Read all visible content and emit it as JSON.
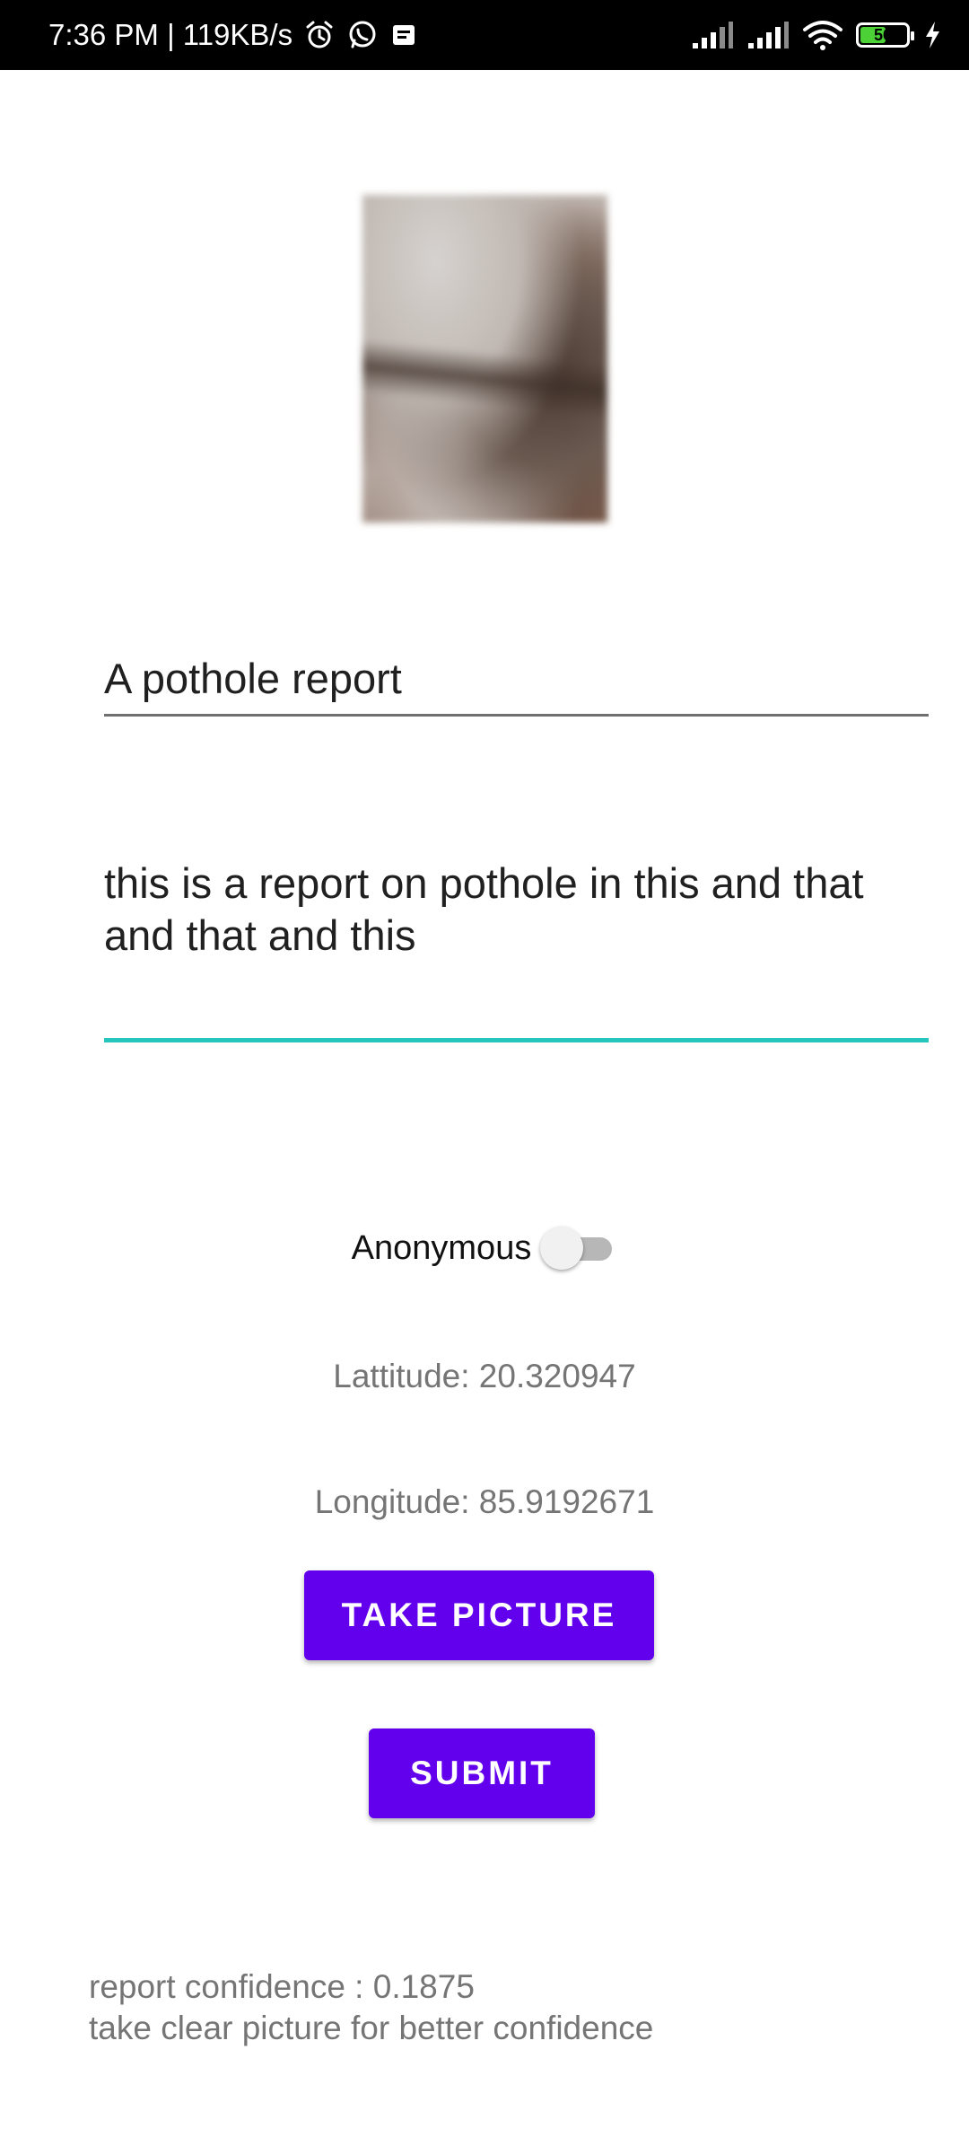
{
  "status_bar": {
    "time_speed": "7:36 PM | 119KB/s",
    "battery_level": "56",
    "battery_fraction": 0.56,
    "icons": [
      "alarm-icon",
      "whatsapp-icon",
      "message-icon",
      "signal-icon",
      "signal-icon",
      "wifi-icon",
      "battery-icon",
      "charging-icon"
    ]
  },
  "form": {
    "title_value": "A pothole report",
    "description_value": "this is a report on pothole in this and that and that and this",
    "anonymous_label": "Anonymous",
    "anonymous_on": false,
    "latitude_text": "Lattitude: 20.320947",
    "longitude_text": "Longitude: 85.9192671",
    "take_picture_label": "TAKE PICTURE",
    "submit_label": "SUBMIT"
  },
  "confidence": {
    "line1": "report confidence : 0.1875",
    "line2": "take clear picture for better confidence"
  },
  "colors": {
    "accent": "#6200ee",
    "focus_underline": "#26c6bd",
    "status_bar": "#000000",
    "battery_green": "#4cd137"
  }
}
